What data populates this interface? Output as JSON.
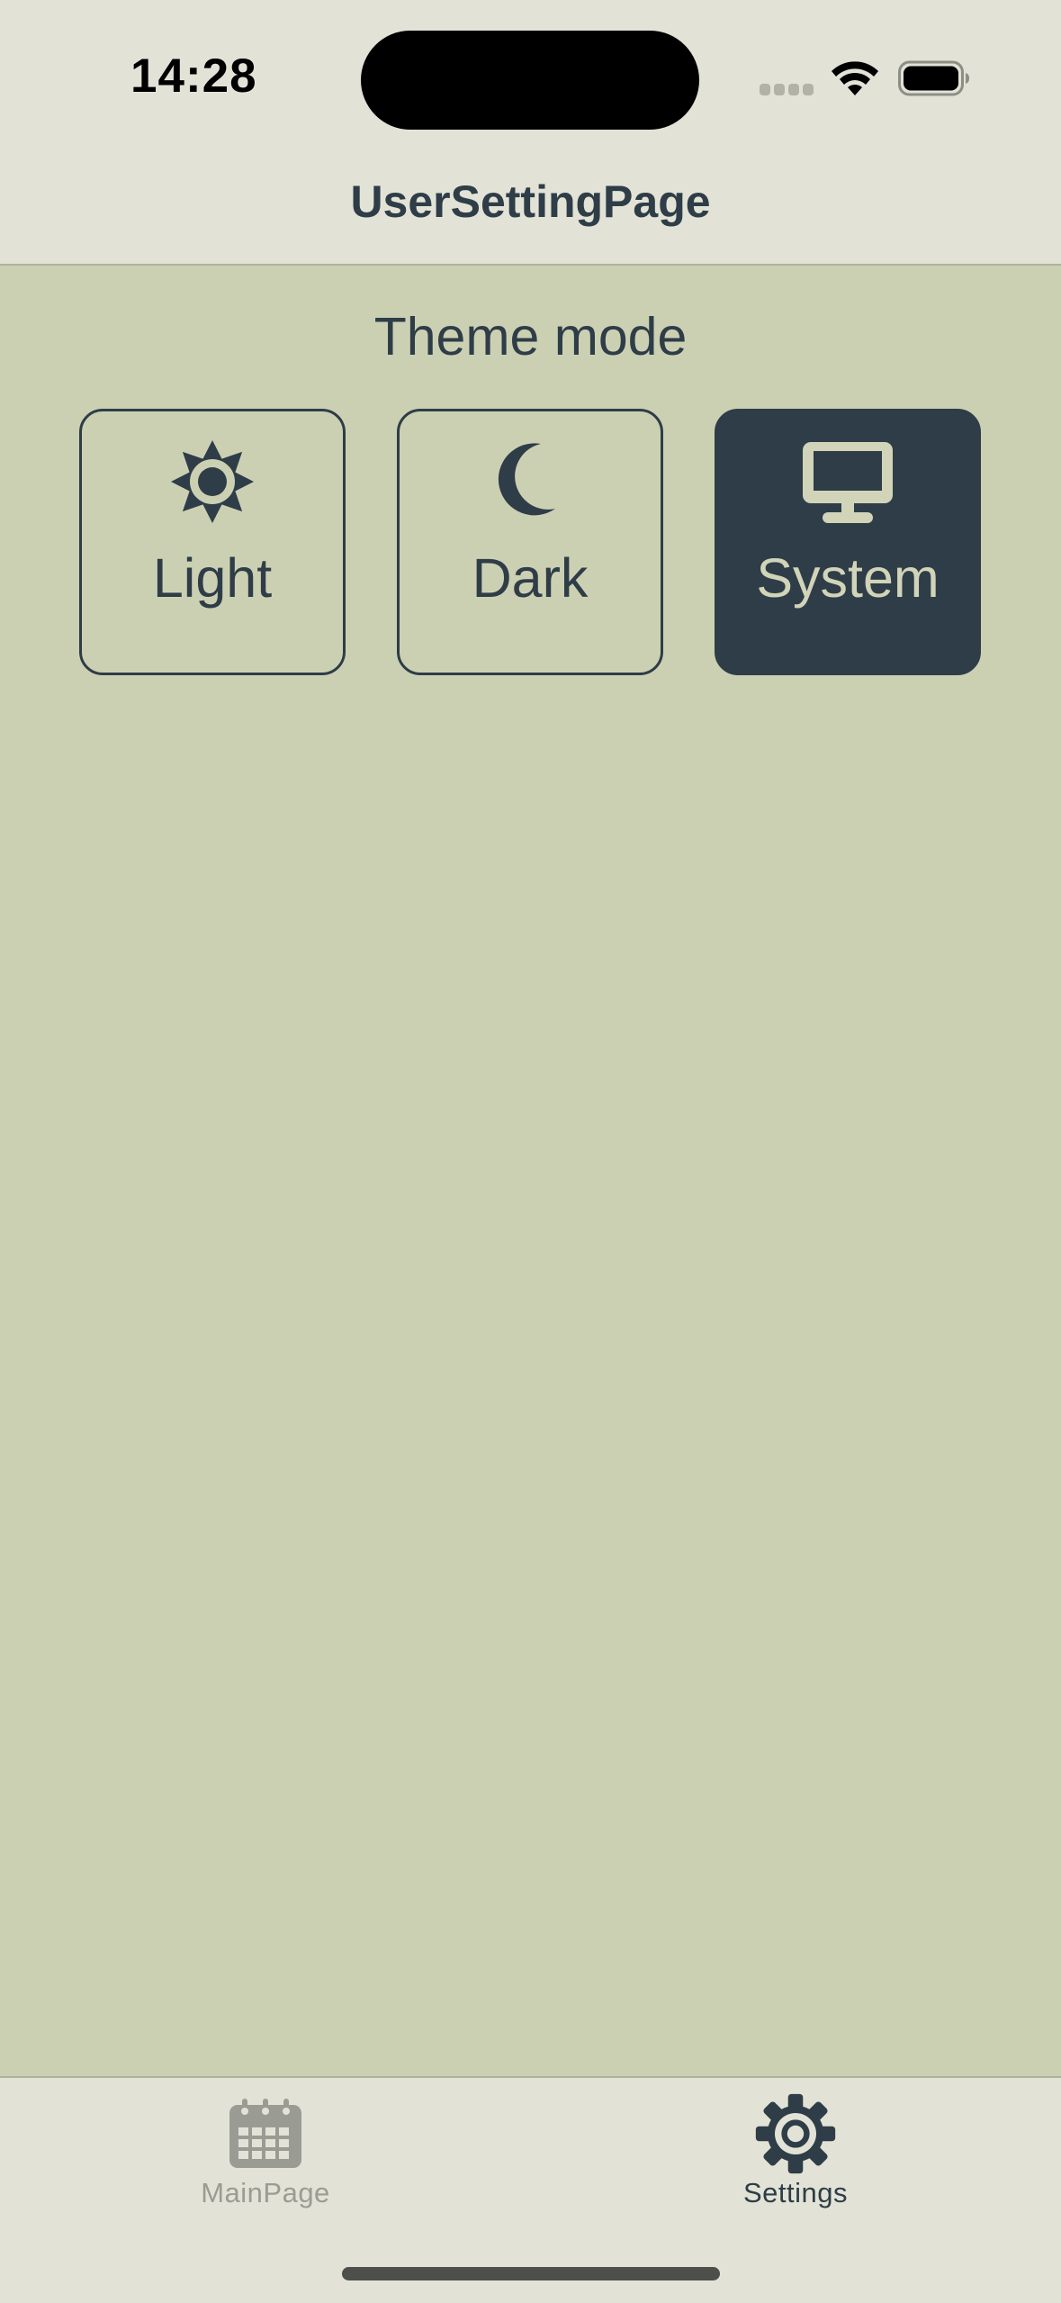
{
  "status_bar": {
    "time": "14:28",
    "signal_icon": "signal-dots-icon",
    "wifi_icon": "wifi-icon",
    "battery_icon": "battery-icon"
  },
  "header": {
    "title": "UserSettingPage"
  },
  "theme_section": {
    "title": "Theme mode",
    "options": [
      {
        "label": "Light",
        "icon": "sun-icon",
        "selected": false
      },
      {
        "label": "Dark",
        "icon": "moon-icon",
        "selected": false
      },
      {
        "label": "System",
        "icon": "monitor-icon",
        "selected": true
      }
    ]
  },
  "tab_bar": {
    "tabs": [
      {
        "label": "MainPage",
        "icon": "calendar-icon",
        "active": false
      },
      {
        "label": "Settings",
        "icon": "gear-icon",
        "active": true
      }
    ]
  },
  "colors": {
    "background": "#ccd0b3",
    "bars": "#e2e3d6",
    "primary": "#2e3d47",
    "inactive": "#9a9c94"
  }
}
